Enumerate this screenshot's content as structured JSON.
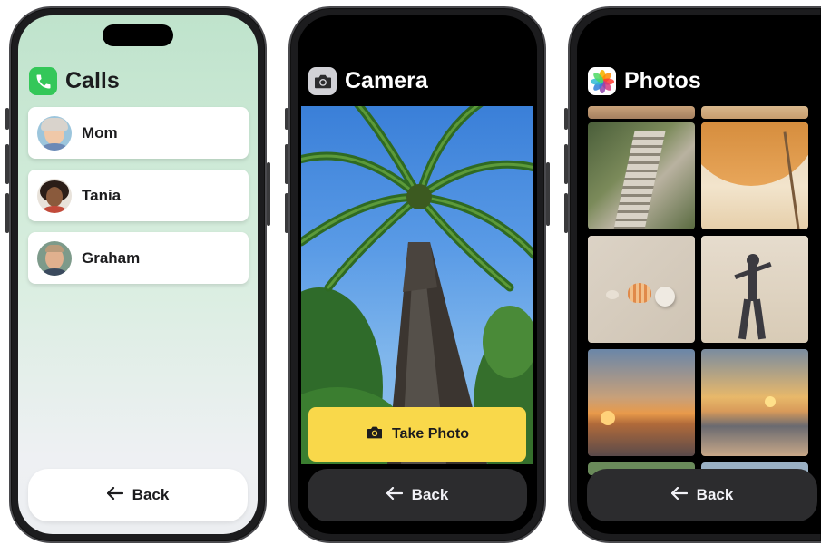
{
  "calls": {
    "title": "Calls",
    "contacts": [
      {
        "name": "Mom"
      },
      {
        "name": "Tania"
      },
      {
        "name": "Graham"
      }
    ],
    "back_label": "Back"
  },
  "camera": {
    "title": "Camera",
    "take_photo_label": "Take Photo",
    "back_label": "Back"
  },
  "photos": {
    "title": "Photos",
    "back_label": "Back"
  },
  "colors": {
    "calls_accent": "#34c759",
    "take_photo_yellow": "#f9d84a",
    "dark_button": "#2c2c2e"
  },
  "icons": [
    "phone-icon",
    "camera-icon",
    "photos-icon",
    "arrow-left-icon"
  ]
}
